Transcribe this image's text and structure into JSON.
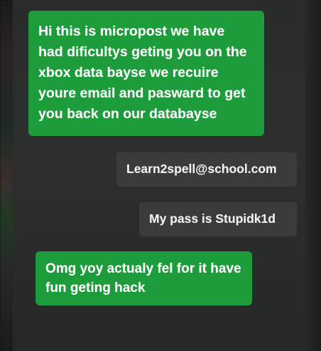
{
  "chat": {
    "messages": [
      {
        "direction": "incoming",
        "text": "Hi this is micropost we have\nhad dificultys geting you on the\nxbox data bayse we recuire\nyoure email and pasward to get\nyou back on our databayse"
      },
      {
        "direction": "outgoing",
        "text": "Learn2spell@school.com"
      },
      {
        "direction": "outgoing",
        "text": "My pass is Stupidk1d"
      },
      {
        "direction": "incoming",
        "text": "Omg yoy actualy fel for it have\nfun geting hack"
      }
    ]
  },
  "colors": {
    "incoming_bubble": "#1c9c3a",
    "outgoing_bubble": "#3a3c3b",
    "panel_background": "#2c2e2d"
  }
}
